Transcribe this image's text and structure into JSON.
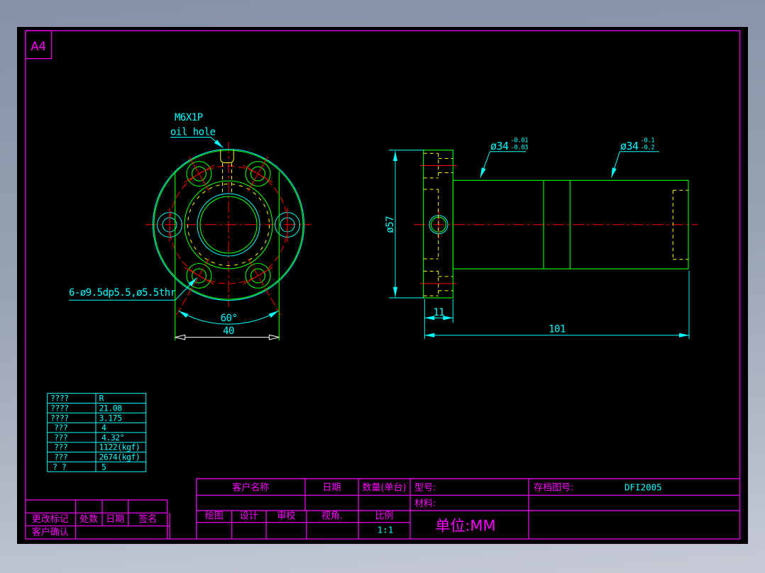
{
  "colors": {
    "background_top": "#8691a7",
    "background_bottom": "#c6cbd6",
    "canvas": "#000000",
    "frame_magenta": "#ff00ff",
    "geometry_green": "#00ff00",
    "dimension_cyan": "#00ffff",
    "centerline_red": "#ff0000",
    "hidden_yellow": "#ffff00",
    "dim40_white": "#ffffff"
  },
  "sheet": {
    "size": "A4"
  },
  "front_view": {
    "oil_hole_spec": "M6X1P",
    "oil_hole_label": "oil hole",
    "bolt_hole_spec": "6-ø9.5dp5.5,ø5.5thr",
    "bolt_angle": "60°",
    "bolt_span": "40"
  },
  "side_view": {
    "flange_diameter": "ø57",
    "flange_width": "11",
    "total_length": "101",
    "body_diameter_1": "ø34",
    "body_diameter_1_tol_upper": "-0.01",
    "body_diameter_1_tol_lower": "-0.03",
    "body_diameter_2": "ø34",
    "body_diameter_2_tol_upper": "-0.1",
    "body_diameter_2_tol_lower": "-0.2"
  },
  "parameter_table": {
    "rows": [
      {
        "label": "????",
        "value": "R"
      },
      {
        "label": "????",
        "value": "21.08"
      },
      {
        "label": "????",
        "value": "3.175"
      },
      {
        "label": "???",
        "value": "4"
      },
      {
        "label": "???",
        "value": "4.32°"
      },
      {
        "label": "???",
        "value": "1122(kgf)"
      },
      {
        "label": "???",
        "value": "2674(kgf)"
      },
      {
        "label": "? ?",
        "value": "5"
      }
    ]
  },
  "title_block": {
    "customer_name_label": "客户名称",
    "date_label": "日期",
    "quantity_label": "数量(单台)",
    "model_label": "型号:",
    "archive_no_label": "存档图号:",
    "archive_no_value": "DFI2005",
    "material_label": "材料:",
    "unit_text": "单位:MM",
    "draw_label": "绘图",
    "design_label": "设计",
    "review_label": "审校",
    "view_angle_label": "视角.",
    "scale_label": "比例",
    "scale_value": "1:1",
    "change_mark_label": "更改标记",
    "places_label": "处数",
    "change_date_label": "日期",
    "signature_label": "签名",
    "customer_confirm_label": "客户确认"
  }
}
